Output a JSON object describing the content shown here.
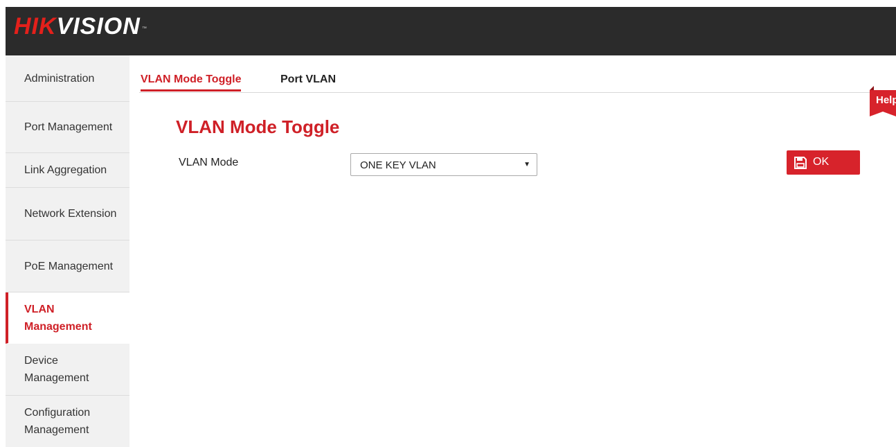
{
  "header": {
    "logo_part1": "HIK",
    "logo_part2": "VISION",
    "logo_tm": "™"
  },
  "sidebar": {
    "items": [
      {
        "label": "Administration",
        "active": false
      },
      {
        "label": "Port Management",
        "active": false
      },
      {
        "label": "Link Aggregation",
        "active": false
      },
      {
        "label": "Network Extension",
        "active": false
      },
      {
        "label": "PoE Management",
        "active": false
      },
      {
        "label": "VLAN Management",
        "active": true
      },
      {
        "label": "Device Management",
        "active": false
      },
      {
        "label": "Configuration Management",
        "active": false
      }
    ]
  },
  "tabs": [
    {
      "label": "VLAN Mode Toggle",
      "active": true
    },
    {
      "label": "Port VLAN",
      "active": false
    }
  ],
  "help": {
    "label": "Help"
  },
  "main": {
    "section_title": "VLAN Mode Toggle",
    "vlan_mode_label": "VLAN Mode",
    "vlan_mode_value": "ONE KEY VLAN",
    "ok_label": "OK"
  },
  "colors": {
    "accent": "#cf2027",
    "header_bg": "#2b2b2b",
    "sidebar_bg": "#f1f1f1"
  },
  "icons": {
    "select_arrow": "caret-down-icon",
    "ok_icon": "floppy-disk-icon",
    "help_icon": "help-bookmark-icon"
  }
}
